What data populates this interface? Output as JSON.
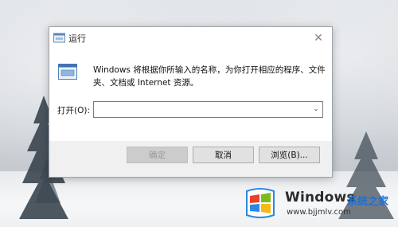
{
  "dialog": {
    "title": "运行",
    "close_glyph": "✕",
    "description": "Windows 将根据你所输入的名称，为你打开相应的程序、文件夹、文档或 Internet 资源。",
    "open_label": "打开(O):",
    "open_value": "",
    "dropdown_glyph": "⌄",
    "buttons": {
      "ok": "确定",
      "cancel": "取消",
      "browse": "浏览(B)..."
    }
  },
  "watermark": {
    "brand": "Windows",
    "sub": "系统之家",
    "url": "www.bjjmlv.com"
  },
  "colors": {
    "accent": "#0078d7",
    "watermark_blue": "#1e6fd6",
    "logo_red": "#e8412c",
    "logo_green": "#7cbb1c",
    "logo_blue": "#2a8ae0",
    "logo_yellow": "#f6b917"
  }
}
